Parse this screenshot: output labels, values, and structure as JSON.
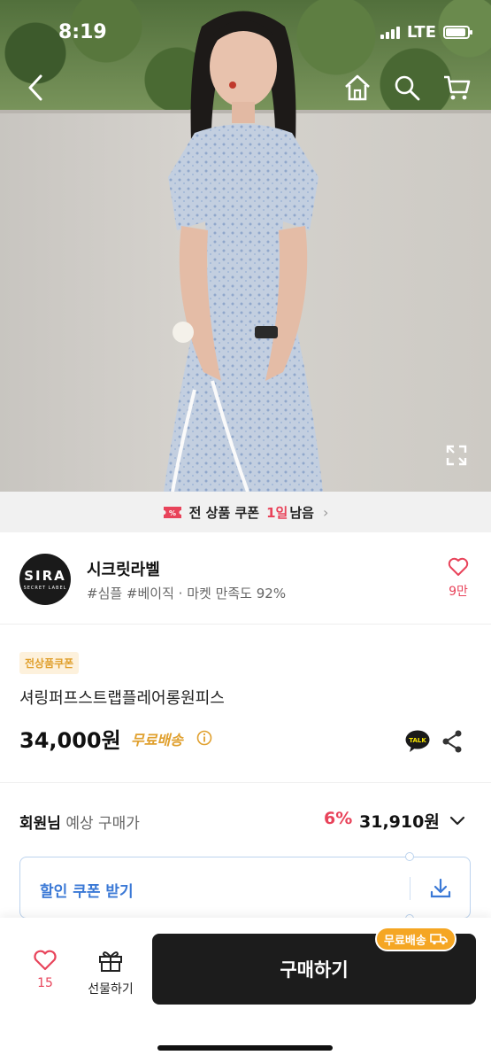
{
  "status": {
    "time": "8:19",
    "network": "LTE"
  },
  "hero": {
    "back_icon": "chevron-left-icon",
    "icons": [
      "home-icon",
      "search-icon",
      "cart-icon"
    ],
    "expand_icon": "expand-icon"
  },
  "banner": {
    "text": "전 상품 쿠폰",
    "days": "1일",
    "left": "남음"
  },
  "seller": {
    "logo_line1": "SIRA",
    "logo_line2": "SECRET LABEL",
    "name": "시크릿라벨",
    "tags": "#심플 #베이직 · 마켓 만족도 92%",
    "fav_count": "9만"
  },
  "product": {
    "tag": "전상품쿠폰",
    "title": "셔링퍼프스트랩플레어롱원피스",
    "price": "34,000원",
    "shipping": "무료배송"
  },
  "member": {
    "label_bold": "회원님",
    "label_rest": " 예상 구매가",
    "discount": "6%",
    "price": "31,910원"
  },
  "coupon": {
    "label": "할인 쿠폰 받기"
  },
  "bottom": {
    "like_count": "15",
    "gift_label": "선물하기",
    "buy_label": "구매하기",
    "free_badge": "무료배송"
  },
  "colors": {
    "accent_pink": "#e8435a",
    "accent_orange": "#e0a02e",
    "accent_blue": "#3b79d6",
    "dark": "#1c1c1c"
  }
}
